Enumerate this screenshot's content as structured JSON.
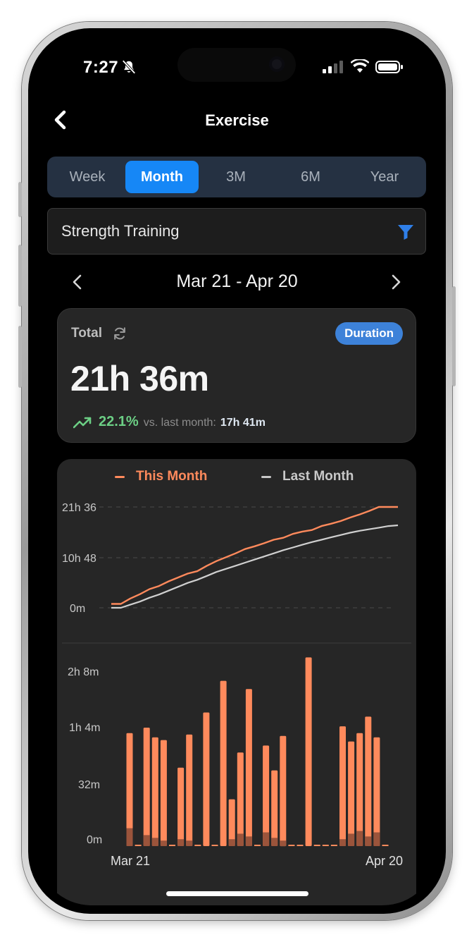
{
  "status_bar": {
    "time": "7:27",
    "bell_icon": "bell-slash-icon",
    "signal_icon": "cellular-signal-icon",
    "wifi_icon": "wifi-icon",
    "battery_icon": "battery-icon"
  },
  "nav": {
    "back_icon": "chevron-left-icon",
    "title": "Exercise"
  },
  "segments": [
    {
      "label": "Week",
      "active": false
    },
    {
      "label": "Month",
      "active": true
    },
    {
      "label": "3M",
      "active": false
    },
    {
      "label": "6M",
      "active": false
    },
    {
      "label": "Year",
      "active": false
    }
  ],
  "filter": {
    "value": "Strength Training",
    "icon": "funnel-icon"
  },
  "date_range": {
    "label": "Mar 21 - Apr 20",
    "prev_icon": "chevron-left-icon",
    "next_icon": "chevron-right-icon"
  },
  "total_card": {
    "label": "Total",
    "refresh_icon": "refresh-icon",
    "badge": "Duration",
    "value": "21h 36m",
    "trend_icon": "trending-up-icon",
    "change_pct": "22.1%",
    "vs_label": "vs. last month:",
    "last_month_value": "17h 41m"
  },
  "colors": {
    "accent": "#1687f6",
    "this_month": "#ff8a5c",
    "last_month": "#d0d0d0",
    "positive": "#6ccf85",
    "badge": "#3d82d9"
  },
  "chart_data": [
    {
      "type": "line",
      "title": "",
      "legend": [
        "This Month",
        "Last Month"
      ],
      "legend_position": "top",
      "y_tick_labels": [
        "21h 36",
        "10h 48",
        "0m"
      ],
      "ylim": [
        0,
        1296
      ],
      "y_unit": "minutes",
      "x_domain": [
        "Mar 21",
        "Apr 20"
      ],
      "grid": "dashed horizontal",
      "series": [
        {
          "name": "This Month",
          "values": [
            50,
            50,
            120,
            175,
            240,
            280,
            340,
            390,
            440,
            470,
            540,
            600,
            650,
            700,
            755,
            790,
            830,
            875,
            900,
            950,
            980,
            1000,
            1050,
            1080,
            1115,
            1160,
            1200,
            1245,
            1296,
            1296,
            1296
          ]
        },
        {
          "name": "Last Month",
          "values": [
            0,
            0,
            40,
            80,
            130,
            170,
            220,
            270,
            320,
            360,
            410,
            460,
            500,
            540,
            580,
            620,
            660,
            700,
            740,
            775,
            810,
            845,
            875,
            905,
            935,
            965,
            990,
            1010,
            1030,
            1050,
            1060
          ]
        }
      ]
    },
    {
      "type": "bar",
      "title": "",
      "y_tick_labels": [
        "2h 8m",
        "1h 4m",
        "32m",
        "0m"
      ],
      "ylim": [
        0,
        128
      ],
      "y_unit": "minutes",
      "x_tick_labels": [
        "Mar 21",
        "Apr 20"
      ],
      "days": 31,
      "values": [
        82,
        0,
        86,
        79,
        77,
        0,
        57,
        81,
        0,
        97,
        0,
        120,
        34,
        68,
        114,
        0,
        73,
        55,
        80,
        0,
        0,
        137,
        0,
        0,
        0,
        87,
        76,
        82,
        94,
        79,
        0
      ],
      "overlay_values": [
        13,
        0,
        8,
        6,
        4,
        0,
        5,
        4,
        0,
        0,
        0,
        0,
        5,
        9,
        7,
        0,
        10,
        6,
        4,
        0,
        0,
        0,
        0,
        0,
        0,
        5,
        9,
        11,
        7,
        10,
        0
      ]
    }
  ]
}
